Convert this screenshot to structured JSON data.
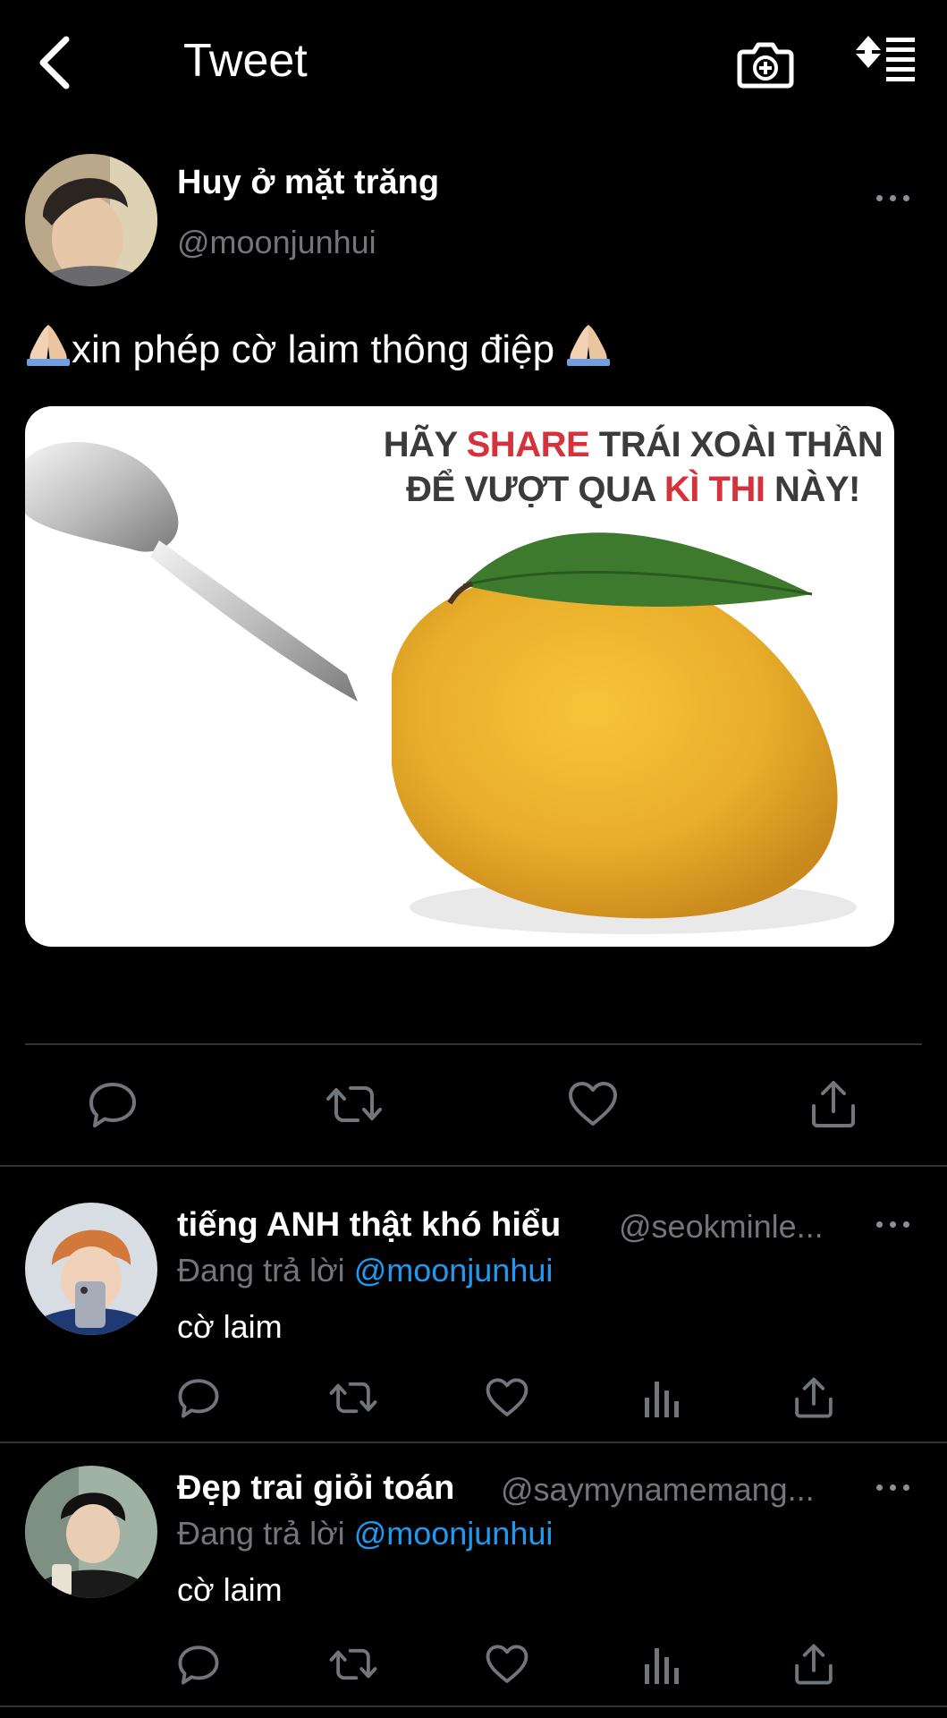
{
  "header": {
    "title": "Tweet",
    "back_icon": "chevron-left-icon",
    "camera_icon": "camera-plus-icon",
    "sort_icon": "sort-lines-icon"
  },
  "tweet": {
    "author_name": "Huy ở mặt trăng",
    "author_handle": "@moonjunhui",
    "text": "xin phép cờ laim thông điệp",
    "emoji": "folded-hands-emoji",
    "media": {
      "line1_a": "HÃY ",
      "line1_red": "SHARE",
      "line1_b": " TRÁI XOÀI THẦN",
      "line2_a": "ĐỂ VƯỢT QUA ",
      "line2_red": "KÌ THI",
      "line2_b": " NÀY!"
    },
    "actions": [
      "reply-icon",
      "retweet-icon",
      "like-icon",
      "share-icon"
    ]
  },
  "replies": [
    {
      "name": "tiếng ANH thật khó hiểu",
      "handle": "@seokminle...",
      "replying_prefix": "Đang trả lời ",
      "replying_to": "@moonjunhui",
      "text": "cờ laim"
    },
    {
      "name": "Đẹp trai giỏi toán",
      "handle": "@saymynamemang...",
      "replying_prefix": "Đang trả lời ",
      "replying_to": "@moonjunhui",
      "text": "cờ laim"
    }
  ],
  "colors": {
    "background": "#000000",
    "secondary_text": "#71767b",
    "link": "#1d9bf0",
    "divider": "#2f3336"
  }
}
